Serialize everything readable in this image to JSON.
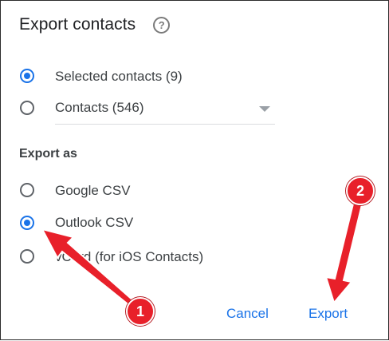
{
  "dialog": {
    "title": "Export contacts",
    "help_icon": "help-circle-icon",
    "help_glyph": "?"
  },
  "source_options": [
    {
      "label": "Selected contacts (9)",
      "checked": true
    },
    {
      "label": "Contacts (546)",
      "checked": false
    }
  ],
  "export_as": {
    "heading": "Export as",
    "options": [
      {
        "label": "Google CSV",
        "checked": false
      },
      {
        "label": "Outlook CSV",
        "checked": true
      },
      {
        "label": "vCard (for iOS Contacts)",
        "checked": false
      }
    ]
  },
  "actions": {
    "cancel_label": "Cancel",
    "export_label": "Export"
  },
  "annotations": {
    "step1": "1",
    "step2": "2"
  },
  "colors": {
    "accent": "#1a73e8",
    "annotation_red": "#e8202a"
  }
}
